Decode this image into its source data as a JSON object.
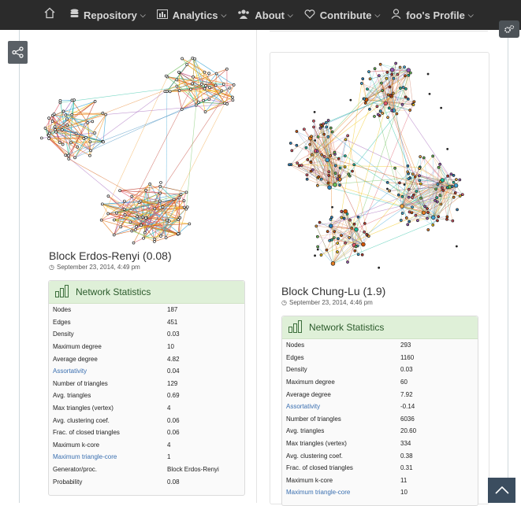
{
  "nav": {
    "home_icon": "home-icon",
    "items": [
      {
        "label": "Repository",
        "icon": "database-icon"
      },
      {
        "label": "Analytics",
        "icon": "bar-chart-icon"
      },
      {
        "label": "About",
        "icon": "users-icon"
      },
      {
        "label": "Contribute",
        "icon": "heart-icon"
      },
      {
        "label": "foo's Profile",
        "icon": "user-icon"
      }
    ]
  },
  "left_network": {
    "title": "Block Erdos-Renyi (0.08)",
    "date": "September 23, 2014, 4:49 pm",
    "stats_heading": "Network Statistics",
    "stats": [
      {
        "key": "Nodes",
        "value": "187"
      },
      {
        "key": "Edges",
        "value": "451"
      },
      {
        "key": "Density",
        "value": "0.03"
      },
      {
        "key": "Maximum degree",
        "value": "10"
      },
      {
        "key": "Average degree",
        "value": "4.82"
      },
      {
        "key": "Assortativity",
        "value": "0.04"
      },
      {
        "key": "Number of triangles",
        "value": "129"
      },
      {
        "key": "Avg. triangles",
        "value": "0.69"
      },
      {
        "key": "Max triangles (vertex)",
        "value": "4"
      },
      {
        "key": "Avg. clustering coef.",
        "value": "0.06"
      },
      {
        "key": "Frac. of closed triangles",
        "value": "0.06"
      },
      {
        "key": "Maximum k-core",
        "value": "4"
      },
      {
        "key": "Maximum triangle-core",
        "value": "1"
      },
      {
        "key": "Generator/proc.",
        "value": "Block Erdos-Renyi"
      },
      {
        "key": "Probability",
        "value": "0.08"
      }
    ]
  },
  "right_network": {
    "title": "Block Chung-Lu (1.9)",
    "date": "September 23, 2014, 4:46 pm",
    "stats_heading": "Network Statistics",
    "stats": [
      {
        "key": "Nodes",
        "value": "293"
      },
      {
        "key": "Edges",
        "value": "1160"
      },
      {
        "key": "Density",
        "value": "0.03"
      },
      {
        "key": "Maximum degree",
        "value": "60"
      },
      {
        "key": "Average degree",
        "value": "7.92"
      },
      {
        "key": "Assortativity",
        "value": "-0.14"
      },
      {
        "key": "Number of triangles",
        "value": "6036"
      },
      {
        "key": "Avg. triangles",
        "value": "20.60"
      },
      {
        "key": "Max triangles (vertex)",
        "value": "334"
      },
      {
        "key": "Avg. clustering coef.",
        "value": "0.38"
      },
      {
        "key": "Frac. of closed triangles",
        "value": "0.31"
      },
      {
        "key": "Maximum k-core",
        "value": "11"
      },
      {
        "key": "Maximum triangle-core",
        "value": "10"
      }
    ]
  },
  "colors": {
    "navbar": "#2b2b2b",
    "stats_header": "#dff0d8",
    "link": "#3a6fb0",
    "scroll_button": "#3b4d5f"
  }
}
